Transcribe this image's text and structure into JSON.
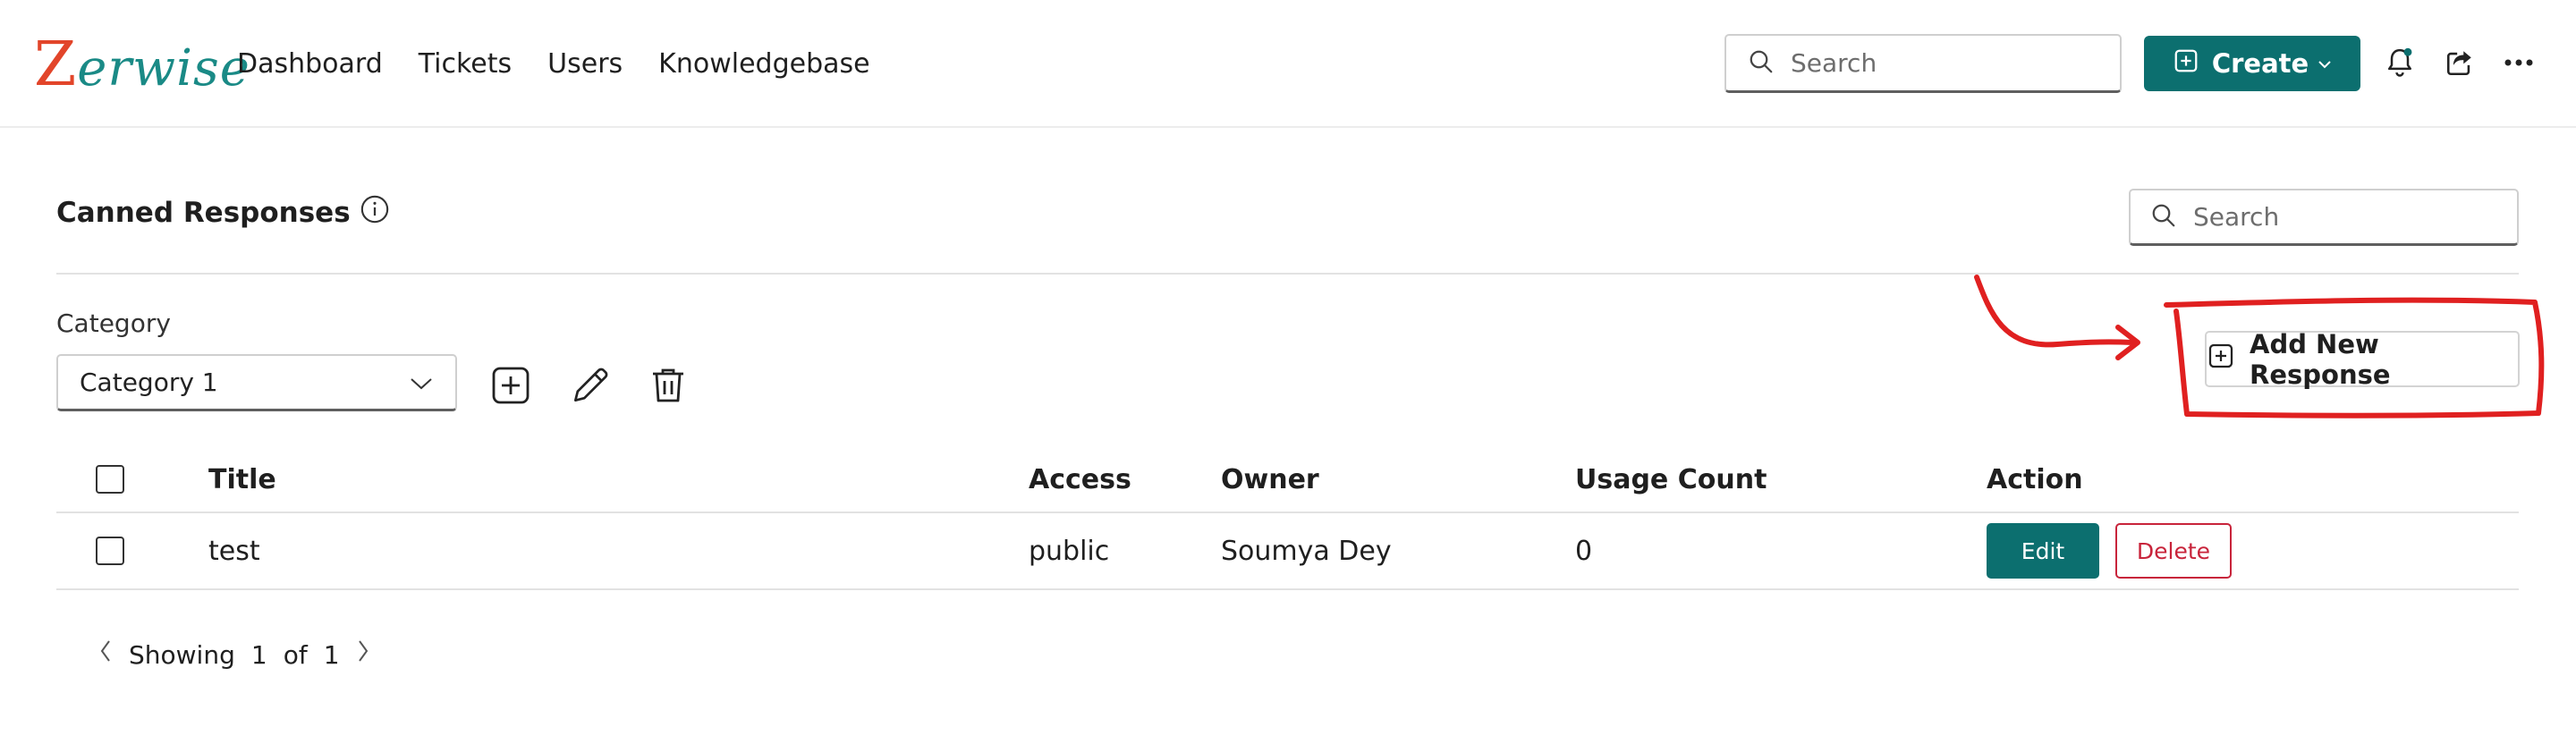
{
  "brand": {
    "logo_text_first": "Z",
    "logo_text_rest": "erwise"
  },
  "nav": [
    "Dashboard",
    "Tickets",
    "Users",
    "Knowledgebase"
  ],
  "topbar": {
    "search_placeholder": "Search",
    "create_label": "Create",
    "icons": [
      "bell-icon",
      "share-icon",
      "more-icon"
    ]
  },
  "page": {
    "title": "Canned Responses",
    "search_placeholder": "Search",
    "category_label": "Category",
    "category_value": "Category 1",
    "add_button": "Add New Response"
  },
  "table": {
    "headers": {
      "title": "Title",
      "access": "Access",
      "owner": "Owner",
      "usage": "Usage Count",
      "action": "Action"
    },
    "rows": [
      {
        "title": "test",
        "access": "public",
        "owner": "Soumya Dey",
        "usage": "0",
        "edit": "Edit",
        "delete": "Delete"
      }
    ]
  },
  "pagination": {
    "showing": "Showing",
    "current": "1",
    "of": "of",
    "total": "1"
  },
  "colors": {
    "primary": "#0c6f6f",
    "danger": "#c8243b",
    "annotation": "#e02020"
  }
}
